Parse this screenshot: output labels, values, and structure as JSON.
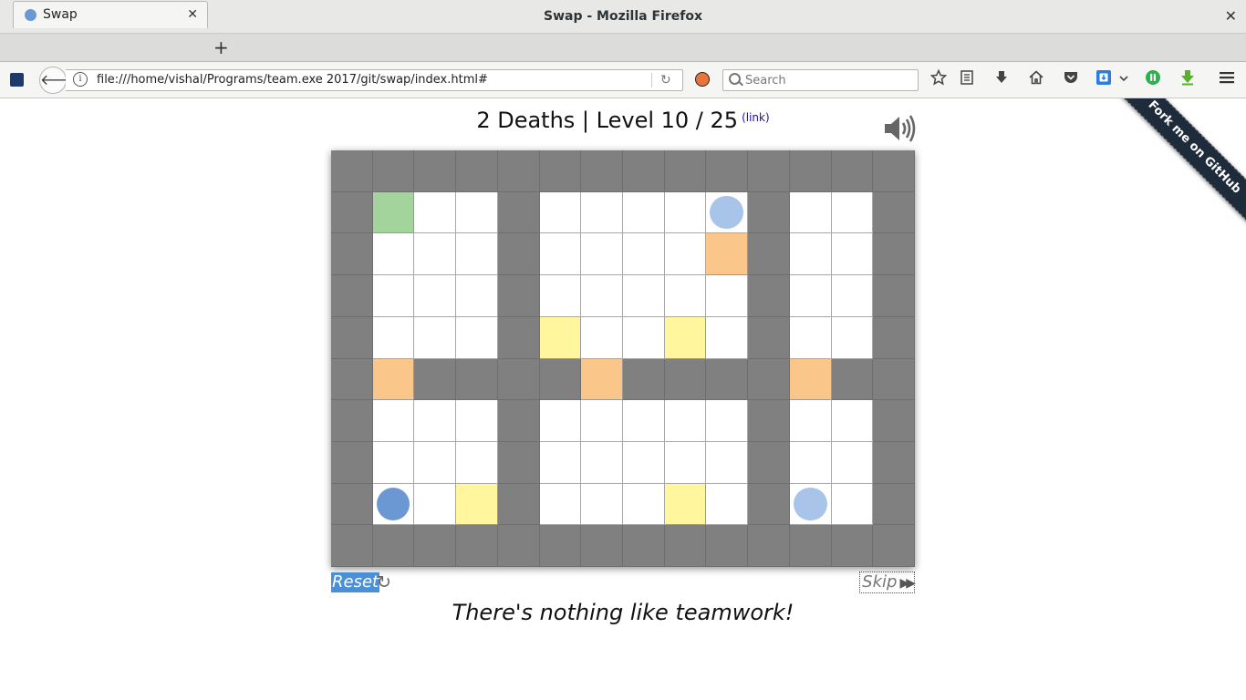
{
  "window": {
    "title": "Swap - Mozilla Firefox",
    "close_glyph": "✕"
  },
  "tabs": [
    {
      "label": "Swap",
      "favicon_color": "#6b98d2",
      "close_glyph": "✕"
    }
  ],
  "newtab_glyph": "+",
  "navbar": {
    "back_glyph": "🡐",
    "url": "file:///home/vishal/Programs/team.exe 2017/git/swap/index.html#",
    "reload_glyph": "↻",
    "search_placeholder": "Search",
    "icons": [
      "star-icon",
      "reading-list-icon",
      "downloads-icon",
      "home-icon",
      "pocket-icon",
      "extension-blue-icon",
      "extension-green-icon",
      "download-arrow-icon",
      "hamburger-menu-icon"
    ]
  },
  "game": {
    "deaths_level": "2 Deaths | Level 10 / 25",
    "link_label": "(link)",
    "reset_label": "Reset",
    "skip_label": "Skip",
    "caption": "There's nothing like teamwork!",
    "ribbon": "Fork me on GitHub",
    "colors": {
      "wall": "#808080",
      "floor": "#ffffff",
      "goal": "#a3d49c",
      "orange": "#fbc68a",
      "yellow": "#fff69e",
      "player_active": "#6b98d2",
      "player_inactive": "#a8c4e8"
    },
    "grid": [
      "WWWWWWWWWWWWWW",
      "WG..W....bW..W",
      "W...W....OW..W",
      "W...W.....W..W",
      "W...WY..Y.W..W",
      "WOWWWWOWWWWOWW",
      "W...W.....W..W",
      "W...W.....W..W",
      "WA.YW...Y.Wb.W",
      "WWWWWWWWWWWWWW"
    ],
    "legend": {
      "W": "wall",
      ".": "floor",
      "G": "goal",
      "O": "orange",
      "Y": "yellow",
      "A": "player-active",
      "b": "player-inactive"
    }
  }
}
